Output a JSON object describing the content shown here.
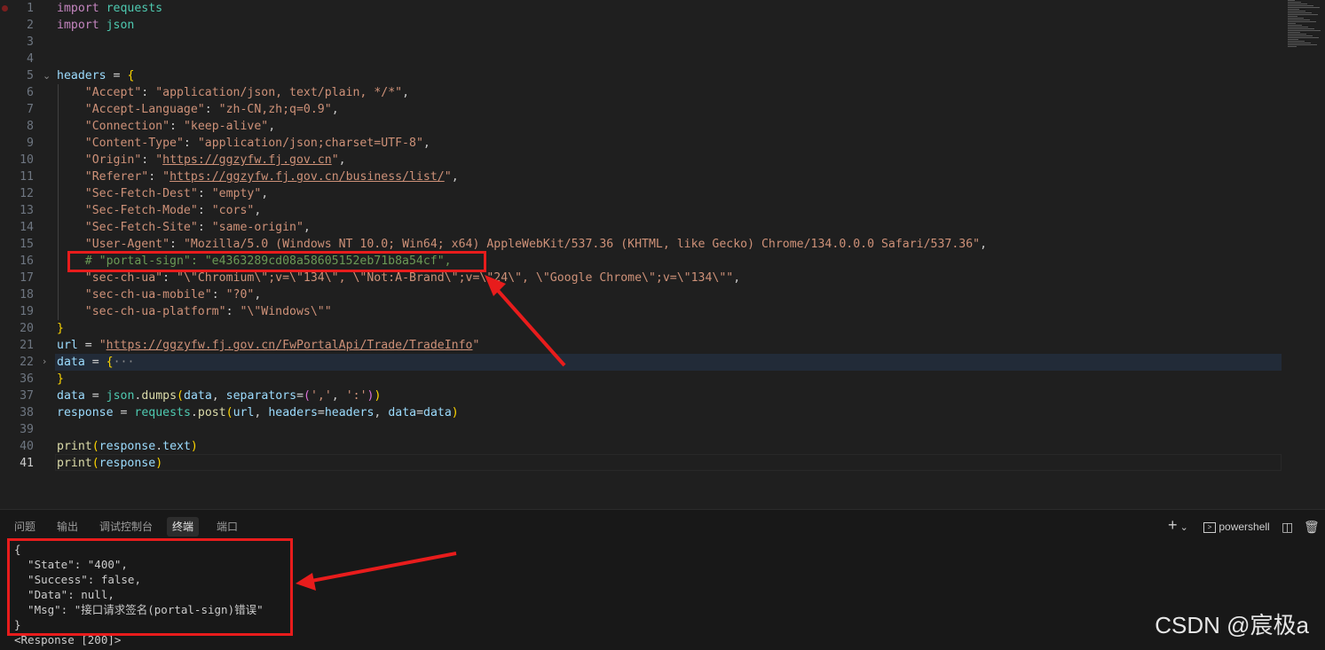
{
  "editor": {
    "lines": [
      {
        "n": "1",
        "html": "<span class='kw'>import</span> <span class='mod'>requests</span>"
      },
      {
        "n": "2",
        "html": "<span class='kw'>import</span> <span class='mod'>json</span>"
      },
      {
        "n": "3",
        "html": ""
      },
      {
        "n": "4",
        "html": ""
      },
      {
        "n": "5",
        "html": "<span class='var'>headers</span> <span class='op'>=</span> <span class='br1'>{</span>"
      },
      {
        "n": "6",
        "html": "    <span class='str'>\"Accept\"</span>: <span class='str'>\"application/json, text/plain, */*\"</span>,"
      },
      {
        "n": "7",
        "html": "    <span class='str'>\"Accept-Language\"</span>: <span class='str'>\"zh-CN,zh;q=0.9\"</span>,"
      },
      {
        "n": "8",
        "html": "    <span class='str'>\"Connection\"</span>: <span class='str'>\"keep-alive\"</span>,"
      },
      {
        "n": "9",
        "html": "    <span class='str'>\"Content-Type\"</span>: <span class='str'>\"application/json;charset=UTF-8\"</span>,"
      },
      {
        "n": "10",
        "html": "    <span class='str'>\"Origin\"</span>: <span class='str'>\"<span class='url'>https://ggzyfw.fj.gov.cn</span>\"</span>,"
      },
      {
        "n": "11",
        "html": "    <span class='str'>\"Referer\"</span>: <span class='str'>\"<span class='url'>https://ggzyfw.fj.gov.cn/business/list/</span>\"</span>,"
      },
      {
        "n": "12",
        "html": "    <span class='str'>\"Sec-Fetch-Dest\"</span>: <span class='str'>\"empty\"</span>,"
      },
      {
        "n": "13",
        "html": "    <span class='str'>\"Sec-Fetch-Mode\"</span>: <span class='str'>\"cors\"</span>,"
      },
      {
        "n": "14",
        "html": "    <span class='str'>\"Sec-Fetch-Site\"</span>: <span class='str'>\"same-origin\"</span>,"
      },
      {
        "n": "15",
        "html": "    <span class='str'>\"User-Agent\"</span>: <span class='str'>\"Mozilla/5.0 (Windows NT 10.0; Win64; x64) AppleWebKit/537.36 (KHTML, like Gecko) Chrome/134.0.0.0 Safari/537.36\"</span>,"
      },
      {
        "n": "16",
        "html": "    <span class='cmt'># \"portal-sign\": \"e4363289cd08a58605152eb71b8a54cf\",</span>"
      },
      {
        "n": "17",
        "html": "    <span class='str'>\"sec-ch-ua\"</span>: <span class='str'>\"\\\"Chromium\\\";v=\\\"134\\\", \\\"Not:A-Brand\\\";v=\\\"24\\\", \\\"Google Chrome\\\";v=\\\"134\\\"\"</span>,"
      },
      {
        "n": "18",
        "html": "    <span class='str'>\"sec-ch-ua-mobile\"</span>: <span class='str'>\"?0\"</span>,"
      },
      {
        "n": "19",
        "html": "    <span class='str'>\"sec-ch-ua-platform\"</span>: <span class='str'>\"\\\"Windows\\\"\"</span>"
      },
      {
        "n": "20",
        "html": "<span class='br1'>}</span>"
      },
      {
        "n": "21",
        "html": "<span class='var'>url</span> <span class='op'>=</span> <span class='str'>\"<span class='url'>https://ggzyfw.fj.gov.cn/FwPortalApi/Trade/TradeInfo</span>\"</span>"
      },
      {
        "n": "22",
        "html": "<span class='var'>data</span> <span class='op'>=</span> <span class='br1'>{</span><span style='color:#8b8b8b'>···</span>"
      },
      {
        "n": "36",
        "html": "<span class='br1'>}</span>"
      },
      {
        "n": "37",
        "html": "<span class='var'>data</span> <span class='op'>=</span> <span class='mod'>json</span>.<span class='fn'>dumps</span><span class='br1'>(</span><span class='var'>data</span>, <span class='var'>separators</span><span class='op'>=</span><span class='br2'>(</span><span class='str'>','</span>, <span class='str'>':'</span><span class='br2'>)</span><span class='br1'>)</span>"
      },
      {
        "n": "38",
        "html": "<span class='var'>response</span> <span class='op'>=</span> <span class='mod'>requests</span>.<span class='fn'>post</span><span class='br1'>(</span><span class='var'>url</span>, <span class='var'>headers</span><span class='op'>=</span><span class='var'>headers</span>, <span class='var'>data</span><span class='op'>=</span><span class='var'>data</span><span class='br1'>)</span>"
      },
      {
        "n": "39",
        "html": ""
      },
      {
        "n": "40",
        "html": "<span class='fn'>print</span><span class='br1'>(</span><span class='var'>response</span>.<span class='var'>text</span><span class='br1'>)</span>"
      },
      {
        "n": "41",
        "html": "<span class='fn'>print</span><span class='br1'>(</span><span class='var'>response</span><span class='br1'>)</span>"
      }
    ]
  },
  "panel": {
    "tabs": [
      "问题",
      "输出",
      "调试控制台",
      "终端",
      "端口"
    ],
    "active_tab": "终端",
    "shell_label": "powershell",
    "add_label": "+",
    "terminal_lines": [
      "{",
      "  \"State\": \"400\",",
      "  \"Success\": false,",
      "  \"Data\": null,",
      "  \"Msg\": \"接口请求签名(portal-sign)错误\"",
      "}",
      "<Response [200]>"
    ]
  },
  "watermark": "CSDN @宸极a",
  "colors": {
    "annotation": "#e81c1c",
    "background": "#1f1f1f"
  }
}
